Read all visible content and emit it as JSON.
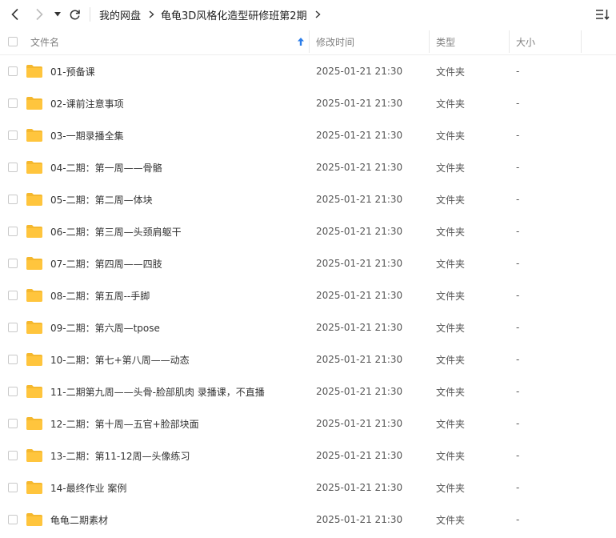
{
  "toolbar": {
    "breadcrumb": [
      "我的网盘",
      "龟龟3D风格化造型研修班第2期"
    ]
  },
  "columns": {
    "name": "文件名",
    "modified": "修改时间",
    "type": "类型",
    "size": "大小"
  },
  "sort": {
    "column": "name",
    "direction": "ascending"
  },
  "files": [
    {
      "name": "01-预备课",
      "modified": "2025-01-21 21:30",
      "type": "文件夹",
      "size": "-"
    },
    {
      "name": "02-课前注意事项",
      "modified": "2025-01-21 21:30",
      "type": "文件夹",
      "size": "-"
    },
    {
      "name": "03-一期录播全集",
      "modified": "2025-01-21 21:30",
      "type": "文件夹",
      "size": "-"
    },
    {
      "name": "04-二期：第一周——骨骼",
      "modified": "2025-01-21 21:30",
      "type": "文件夹",
      "size": "-"
    },
    {
      "name": "05-二期：第二周—体块",
      "modified": "2025-01-21 21:30",
      "type": "文件夹",
      "size": "-"
    },
    {
      "name": "06-二期：第三周—头颈肩躯干",
      "modified": "2025-01-21 21:30",
      "type": "文件夹",
      "size": "-"
    },
    {
      "name": "07-二期：第四周——四肢",
      "modified": "2025-01-21 21:30",
      "type": "文件夹",
      "size": "-"
    },
    {
      "name": "08-二期：第五周--手脚",
      "modified": "2025-01-21 21:30",
      "type": "文件夹",
      "size": "-"
    },
    {
      "name": "09-二期：第六周—tpose",
      "modified": "2025-01-21 21:30",
      "type": "文件夹",
      "size": "-"
    },
    {
      "name": "10-二期：第七+第八周——动态",
      "modified": "2025-01-21 21:30",
      "type": "文件夹",
      "size": "-"
    },
    {
      "name": "11-二期第九周——头骨-脸部肌肉 录播课，不直播",
      "modified": "2025-01-21 21:30",
      "type": "文件夹",
      "size": "-"
    },
    {
      "name": "12-二期：第十周—五官+脸部块面",
      "modified": "2025-01-21 21:30",
      "type": "文件夹",
      "size": "-"
    },
    {
      "name": "13-二期：第11-12周—头像练习",
      "modified": "2025-01-21 21:30",
      "type": "文件夹",
      "size": "-"
    },
    {
      "name": "14-最终作业 案例",
      "modified": "2025-01-21 21:30",
      "type": "文件夹",
      "size": "-"
    },
    {
      "name": "龟龟二期素材",
      "modified": "2025-01-21 21:30",
      "type": "文件夹",
      "size": "-"
    }
  ],
  "colors": {
    "folder": "#ffc53d",
    "folder_back": "#f5b82e",
    "accent": "#2b7de9"
  }
}
